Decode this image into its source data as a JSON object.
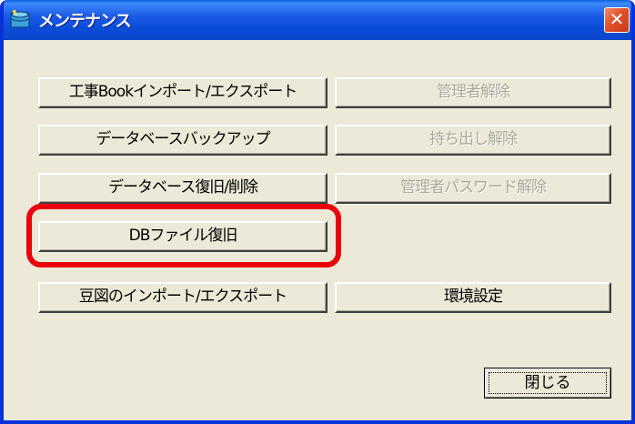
{
  "window": {
    "title": "メンテナンス",
    "close_glyph": "✕"
  },
  "buttons": {
    "koji_book_import_export": "工事Bookインポート/エクスポート",
    "admin_release": "管理者解除",
    "database_backup": "データベースバックアップ",
    "checkout_release": "持ち出し解除",
    "database_restore_delete": "データベース復旧/削除",
    "admin_password_release": "管理者パスワード解除",
    "db_file_restore": "DBファイル復旧",
    "mameizu_import_export": "豆図のインポート/エクスポート",
    "environment_settings": "環境設定",
    "close": "閉じる"
  },
  "colors": {
    "highlight": "#e8000b",
    "titlebar": "#0b4dd8",
    "face": "#ece9d8"
  }
}
